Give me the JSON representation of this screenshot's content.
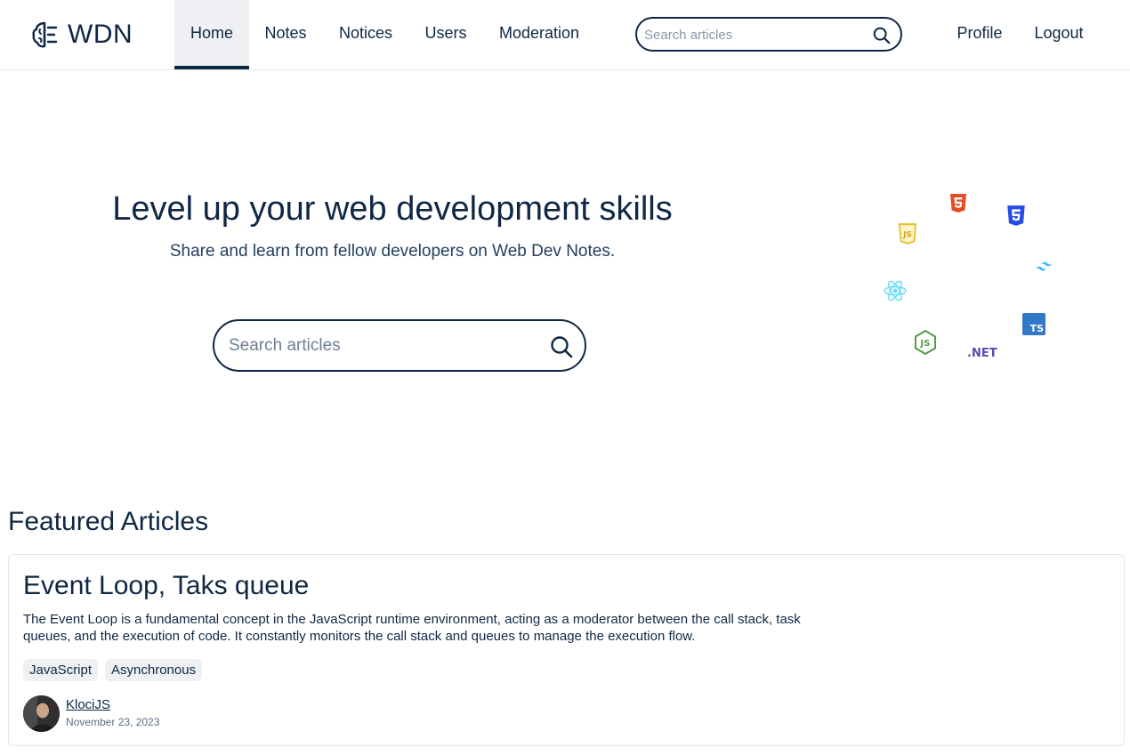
{
  "brand": {
    "name": "WDN"
  },
  "nav": {
    "links": [
      {
        "label": "Home",
        "active": true
      },
      {
        "label": "Notes"
      },
      {
        "label": "Notices"
      },
      {
        "label": "Users"
      },
      {
        "label": "Moderation"
      }
    ],
    "search_placeholder": "Search articles",
    "profile": "Profile",
    "logout": "Logout"
  },
  "hero": {
    "title": "Level up your web development skills",
    "subtitle": "Share and learn from fellow developers on Web Dev Notes.",
    "search_placeholder": "Search articles",
    "tech_icons": [
      "html5-icon",
      "css3-icon",
      "javascript-icon",
      "tailwind-icon",
      "react-icon",
      "typescript-icon",
      "nodejs-icon",
      "dotnet-icon"
    ],
    "dotnet_label": ".NET",
    "ts_label": "TS"
  },
  "featured": {
    "heading": "Featured Articles",
    "articles": [
      {
        "title": "Event Loop, Taks queue",
        "description": "The Event Loop is a fundamental concept in the JavaScript runtime environment, acting as a moderator between the call stack, task queues, and the execution of code. It constantly monitors the call stack and queues to manage the execution flow.",
        "tags": [
          "JavaScript",
          "Asynchronous"
        ],
        "author": "KlociJS",
        "date": "November 23, 2023"
      }
    ]
  },
  "colors": {
    "primary": "#0f2744",
    "html5": "#e44d26",
    "css3": "#264de4",
    "js": "#e8c02a",
    "tailwind": "#38bdf8",
    "react": "#61dafb",
    "typescript": "#3178c6",
    "nodejs": "#539e43",
    "dotnet": "#5c4bb0"
  }
}
